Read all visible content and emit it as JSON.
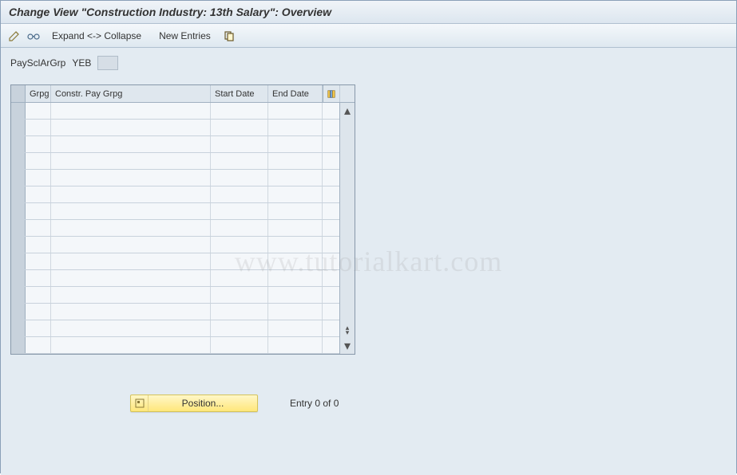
{
  "title": "Change View \"Construction Industry: 13th Salary\": Overview",
  "toolbar": {
    "expand_collapse": "Expand <-> Collapse",
    "new_entries": "New Entries"
  },
  "field": {
    "label": "PaySclArGrp",
    "value": "YEB"
  },
  "table": {
    "columns": {
      "grpg": "Grpg",
      "constr": "Constr. Pay Grpg",
      "start": "Start Date",
      "end": "End Date"
    },
    "rows": [
      {
        "grpg": "",
        "constr": "",
        "start": "",
        "end": ""
      },
      {
        "grpg": "",
        "constr": "",
        "start": "",
        "end": ""
      },
      {
        "grpg": "",
        "constr": "",
        "start": "",
        "end": ""
      },
      {
        "grpg": "",
        "constr": "",
        "start": "",
        "end": ""
      },
      {
        "grpg": "",
        "constr": "",
        "start": "",
        "end": ""
      },
      {
        "grpg": "",
        "constr": "",
        "start": "",
        "end": ""
      },
      {
        "grpg": "",
        "constr": "",
        "start": "",
        "end": ""
      },
      {
        "grpg": "",
        "constr": "",
        "start": "",
        "end": ""
      },
      {
        "grpg": "",
        "constr": "",
        "start": "",
        "end": ""
      },
      {
        "grpg": "",
        "constr": "",
        "start": "",
        "end": ""
      },
      {
        "grpg": "",
        "constr": "",
        "start": "",
        "end": ""
      },
      {
        "grpg": "",
        "constr": "",
        "start": "",
        "end": ""
      },
      {
        "grpg": "",
        "constr": "",
        "start": "",
        "end": ""
      },
      {
        "grpg": "",
        "constr": "",
        "start": "",
        "end": ""
      },
      {
        "grpg": "",
        "constr": "",
        "start": "",
        "end": ""
      }
    ]
  },
  "footer": {
    "position": "Position...",
    "entry": "Entry 0 of 0"
  },
  "watermark": "www.tutorialkart.com"
}
